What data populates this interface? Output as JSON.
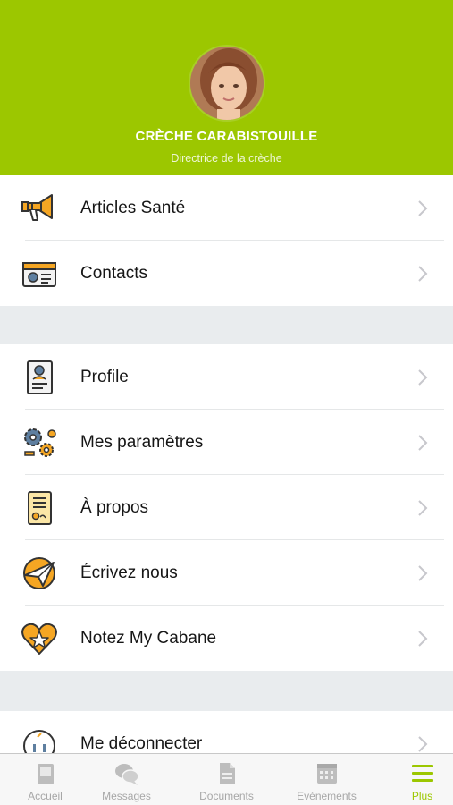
{
  "header": {
    "org_name": "CRÈCHE CARABISTOUILLE",
    "role": "Directrice de la crèche"
  },
  "menu": {
    "group1": [
      {
        "label": "Articles Santé",
        "icon": "megaphone-icon"
      },
      {
        "label": "Contacts",
        "icon": "contact-card-icon"
      }
    ],
    "group2": [
      {
        "label": "Profile",
        "icon": "profile-badge-icon"
      },
      {
        "label": "Mes paramètres",
        "icon": "gears-icon"
      },
      {
        "label": "À propos",
        "icon": "certificate-icon"
      },
      {
        "label": "Écrivez nous",
        "icon": "paper-plane-icon"
      },
      {
        "label": "Notez My Cabane",
        "icon": "heart-star-icon"
      }
    ],
    "group3": [
      {
        "label": "Me déconnecter",
        "icon": "logout-icon"
      }
    ]
  },
  "tabbar": {
    "tabs": [
      {
        "label": "Accueil",
        "icon": "home-icon",
        "active": false
      },
      {
        "label": "Messages",
        "icon": "messages-icon",
        "active": false
      },
      {
        "label": "Documents",
        "icon": "document-icon",
        "active": false
      },
      {
        "label": "Evénements",
        "icon": "calendar-icon",
        "active": false
      },
      {
        "label": "Plus",
        "icon": "menu-icon",
        "active": true
      }
    ]
  },
  "colors": {
    "brand_green": "#9cc700",
    "icon_orange": "#f5a623",
    "inactive_tab": "#a7a7a7"
  }
}
